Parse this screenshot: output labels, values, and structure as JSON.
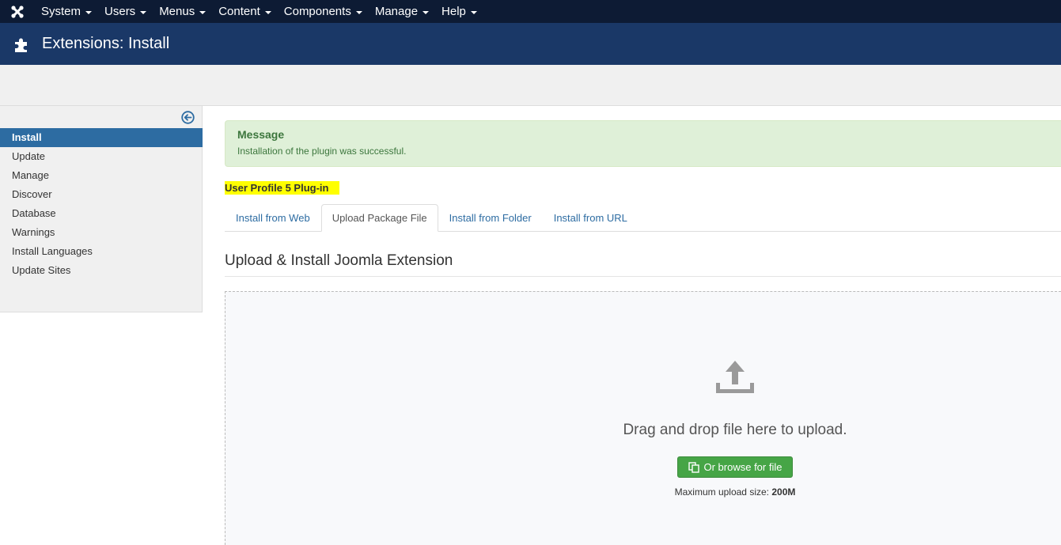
{
  "topnav": {
    "items": [
      {
        "label": "System"
      },
      {
        "label": "Users"
      },
      {
        "label": "Menus"
      },
      {
        "label": "Content"
      },
      {
        "label": "Components"
      },
      {
        "label": "Manage"
      },
      {
        "label": "Help"
      }
    ]
  },
  "header": {
    "title": "Extensions: Install",
    "icon": "puzzle-icon"
  },
  "sidebar": {
    "items": [
      {
        "label": "Install",
        "active": true
      },
      {
        "label": "Update"
      },
      {
        "label": "Manage"
      },
      {
        "label": "Discover"
      },
      {
        "label": "Database"
      },
      {
        "label": "Warnings"
      },
      {
        "label": "Install Languages"
      },
      {
        "label": "Update Sites"
      }
    ]
  },
  "alert": {
    "title": "Message",
    "text": "Installation of the plugin was successful."
  },
  "highlight": "User Profile 5 Plug-in",
  "tabs": [
    {
      "label": "Install from Web"
    },
    {
      "label": "Upload Package File",
      "active": true
    },
    {
      "label": "Install from Folder"
    },
    {
      "label": "Install from URL"
    }
  ],
  "section": {
    "title": "Upload & Install Joomla Extension"
  },
  "dropzone": {
    "text": "Drag and drop file here to upload.",
    "button_label": "Or browse for file",
    "max_label": "Maximum upload size:",
    "max_value": "200M"
  },
  "colors": {
    "navbar": "#0d1b34",
    "header": "#1a3867",
    "active": "#2d6ca2",
    "success": "#46a546"
  }
}
